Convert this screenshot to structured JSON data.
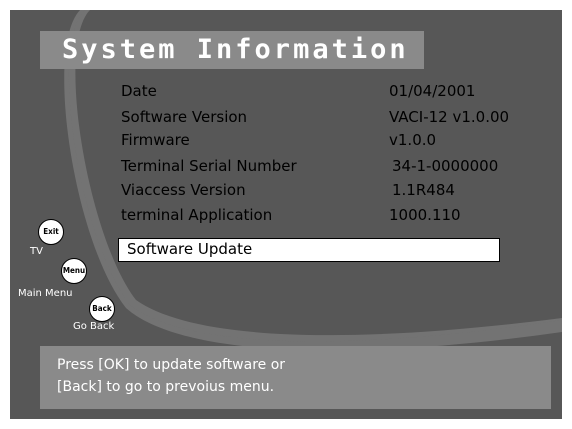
{
  "title": "System Information",
  "info_rows": [
    {
      "label": "Date",
      "value": "01/04/2001"
    },
    {
      "label": "Software Version",
      "value": "VACI-12 v1.0.00"
    },
    {
      "label": "Firmware",
      "value": "v1.0.0"
    },
    {
      "label": "Terminal Serial Number",
      "value": "34-1-0000000"
    },
    {
      "label": "Viaccess Version",
      "value": "1.1R484"
    },
    {
      "label": "terminal Application",
      "value": "1000.110"
    }
  ],
  "menu_option": "Software Update",
  "keys": [
    {
      "key": "Exit",
      "caption": "TV"
    },
    {
      "key": "Menu",
      "caption": "Main Menu"
    },
    {
      "key": "Back",
      "caption": "Go Back"
    }
  ],
  "help": {
    "line1": "Press [OK] to update software or",
    "line2": "[Back] to go to prevoius menu."
  },
  "colors": {
    "background_dark": "#575757",
    "panel_gray": "#8a8a8a",
    "swoosh_white": "#ffffff",
    "text_dark": "#000000",
    "text_light": "#ffffff"
  }
}
